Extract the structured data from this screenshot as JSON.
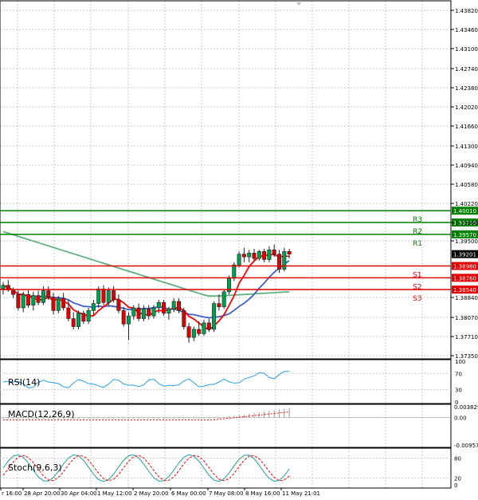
{
  "colors": {
    "background": "#ffffff",
    "grid": "#c8c8c8",
    "frame": "#000000",
    "bull_candle": "#00a050",
    "bear_candle": "#e00000",
    "resistance": "#008000",
    "support": "#e00000",
    "ma_fast": "#ff0000",
    "ma_mid": "#4060c8",
    "ma_slow": "#60b080",
    "rsi": "#2aa0e0",
    "macd_signal": "#ff0000",
    "stoch_main": "#20a0a0",
    "stoch_signal": "#ff0000",
    "price_label_bg": "#008000",
    "support_label_bg": "#e00000",
    "last_price_bg": "#000000"
  },
  "main": {
    "price_ticks": [
      "1.43820",
      "1.43460",
      "1.43100",
      "1.42740",
      "1.42380",
      "1.42020",
      "1.41660",
      "1.41300",
      "1.40940",
      "1.40580",
      "1.40220",
      "1.39860",
      "1.39500",
      "1.38840",
      "1.38070",
      "1.37710",
      "1.37350"
    ],
    "levels": [
      {
        "name": "R3",
        "price": "1.40010",
        "type": "resistance"
      },
      {
        "name": "R2",
        "price": "1.39790",
        "type": "resistance"
      },
      {
        "name": "R1",
        "price": "1.39570",
        "type": "resistance"
      },
      {
        "name": "S1",
        "price": "1.38980",
        "type": "support"
      },
      {
        "name": "S2",
        "price": "1.38760",
        "type": "support"
      },
      {
        "name": "S3",
        "price": "1.38540",
        "type": "support"
      }
    ],
    "last_price": "1.39201"
  },
  "indicators": {
    "rsi": {
      "label": "RSI(14)",
      "ticks": [
        "100",
        "70",
        "30",
        "0"
      ]
    },
    "macd": {
      "label": "MACD(12,26,9)",
      "ticks": [
        "0.003829",
        "0.00",
        "-0.00957"
      ]
    },
    "stoch": {
      "label": "Stoch(9,6,3)",
      "ticks": [
        "80",
        "20",
        "0"
      ]
    }
  },
  "time_axis": [
    "r 16:00",
    "28 Apr 20:00",
    "30 Apr 04:00",
    "1 May 12:00",
    "2 May 20:00",
    "6 May 00:00",
    "7 May 08:00",
    "8 May 16:00",
    "11 May 21:01"
  ],
  "chart_data": {
    "type": "candlestick",
    "title": "",
    "price_range": [
      1.3725,
      1.4392
    ],
    "candles": [
      [
        1.3855,
        1.3868,
        1.3845,
        1.3862
      ],
      [
        1.3862,
        1.3872,
        1.385,
        1.3853
      ],
      [
        1.3853,
        1.3858,
        1.3838,
        1.3845
      ],
      [
        1.3845,
        1.3852,
        1.3815,
        1.382
      ],
      [
        1.382,
        1.385,
        1.3812,
        1.3845
      ],
      [
        1.3845,
        1.3855,
        1.382,
        1.3825
      ],
      [
        1.3825,
        1.385,
        1.3815,
        1.3843
      ],
      [
        1.3843,
        1.3852,
        1.3825,
        1.383
      ],
      [
        1.383,
        1.386,
        1.3825,
        1.3852
      ],
      [
        1.3852,
        1.386,
        1.3835,
        1.384
      ],
      [
        1.384,
        1.3848,
        1.3808,
        1.3815
      ],
      [
        1.3815,
        1.3842,
        1.381,
        1.3838
      ],
      [
        1.3838,
        1.3848,
        1.3815,
        1.382
      ],
      [
        1.382,
        1.3835,
        1.3795,
        1.38
      ],
      [
        1.38,
        1.3812,
        1.378,
        1.3785
      ],
      [
        1.3785,
        1.3815,
        1.378,
        1.381
      ],
      [
        1.381,
        1.3815,
        1.379,
        1.3795
      ],
      [
        1.3795,
        1.382,
        1.379,
        1.3815
      ],
      [
        1.3815,
        1.3835,
        1.3805,
        1.3828
      ],
      [
        1.3828,
        1.386,
        1.382,
        1.3855
      ],
      [
        1.3855,
        1.3862,
        1.3825,
        1.383
      ],
      [
        1.383,
        1.3858,
        1.3822,
        1.3852
      ],
      [
        1.3852,
        1.386,
        1.383,
        1.3835
      ],
      [
        1.3835,
        1.3845,
        1.381,
        1.3815
      ],
      [
        1.3815,
        1.3822,
        1.3785,
        1.379
      ],
      [
        1.379,
        1.3812,
        1.376,
        1.3805
      ],
      [
        1.3805,
        1.3825,
        1.3798,
        1.382
      ],
      [
        1.382,
        1.3828,
        1.3795,
        1.38
      ],
      [
        1.38,
        1.3825,
        1.3795,
        1.3818
      ],
      [
        1.3818,
        1.3825,
        1.3798,
        1.3805
      ],
      [
        1.3805,
        1.3825,
        1.38,
        1.382
      ],
      [
        1.382,
        1.3835,
        1.381,
        1.383
      ],
      [
        1.383,
        1.3835,
        1.3805,
        1.381
      ],
      [
        1.381,
        1.3822,
        1.3798,
        1.3818
      ],
      [
        1.3818,
        1.3838,
        1.3812,
        1.3832
      ],
      [
        1.3832,
        1.3838,
        1.381,
        1.3815
      ],
      [
        1.3815,
        1.382,
        1.378,
        1.3785
      ],
      [
        1.3785,
        1.3792,
        1.3755,
        1.3765
      ],
      [
        1.3765,
        1.3785,
        1.3758,
        1.378
      ],
      [
        1.378,
        1.3795,
        1.3768,
        1.3772
      ],
      [
        1.3772,
        1.3798,
        1.3768,
        1.3792
      ],
      [
        1.3792,
        1.38,
        1.3775,
        1.378
      ],
      [
        1.378,
        1.3832,
        1.3775,
        1.3828
      ],
      [
        1.3828,
        1.3845,
        1.3815,
        1.3822
      ],
      [
        1.3822,
        1.3855,
        1.3818,
        1.385
      ],
      [
        1.385,
        1.388,
        1.3845,
        1.3875
      ],
      [
        1.3875,
        1.3905,
        1.387,
        1.39
      ],
      [
        1.39,
        1.3925,
        1.3895,
        1.392
      ],
      [
        1.392,
        1.3932,
        1.3905,
        1.3915
      ],
      [
        1.3915,
        1.3928,
        1.3905,
        1.3922
      ],
      [
        1.3922,
        1.393,
        1.3908,
        1.3912
      ],
      [
        1.3912,
        1.3928,
        1.3908,
        1.3925
      ],
      [
        1.3925,
        1.393,
        1.3905,
        1.391
      ],
      [
        1.391,
        1.3935,
        1.3905,
        1.3928
      ],
      [
        1.3928,
        1.3938,
        1.3915,
        1.392
      ],
      [
        1.392,
        1.3928,
        1.3885,
        1.3892
      ],
      [
        1.3892,
        1.3932,
        1.3888,
        1.3925
      ],
      [
        1.3925,
        1.393,
        1.3912,
        1.392
      ]
    ]
  }
}
